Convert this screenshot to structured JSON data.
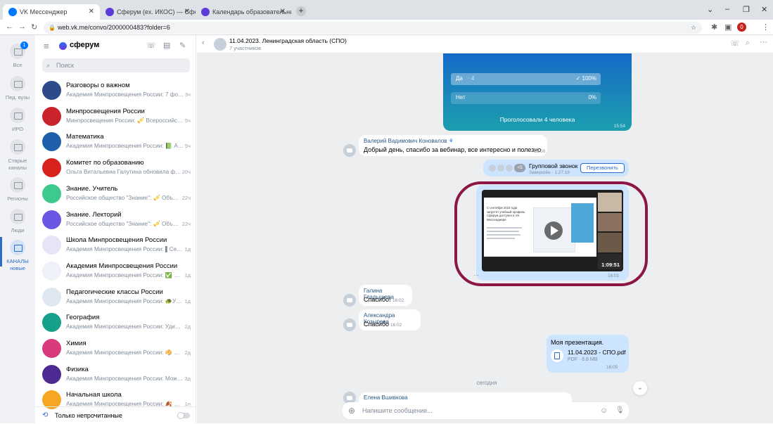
{
  "browser": {
    "tabs": [
      {
        "title": "VK Мессенджер",
        "color": "#0077ff"
      },
      {
        "title": "Сферум (ex. ИКОС) — Сферум",
        "color": "#5b3bd6"
      },
      {
        "title": "Календарь образовательных м…",
        "color": "#5b3bd6"
      }
    ],
    "url": "web.vk.me/convo/2000000483?folder=6",
    "profile_initial": "0"
  },
  "rail": {
    "badge": "1",
    "items": [
      {
        "label": "Все"
      },
      {
        "label": "Пед. вузы"
      },
      {
        "label": "ИРО"
      },
      {
        "label": "Старые каналы"
      },
      {
        "label": "Регионы"
      },
      {
        "label": "Люди"
      },
      {
        "label": "КАНАЛЫ новые"
      }
    ]
  },
  "sidebar": {
    "logo": "сферум",
    "search_placeholder": "Поиск",
    "chats": [
      {
        "name": "Разговоры о важном",
        "preview": "Академия Минпросвещения России: 7 фо…",
        "time": "3ч",
        "color": "#2d4a8a",
        "badge": "РАЗГОВОРЫ О ВАЖНОМ"
      },
      {
        "name": "Минпросвещения России",
        "preview": "Минпросвещения России: 🎺 Всероссийс…",
        "time": "5ч",
        "color": "#c9242b",
        "badge": ""
      },
      {
        "name": "Математика",
        "preview": "Академия Минпросвещения России: 📗 А…",
        "time": "5ч",
        "color": "#1d5fa8",
        "badge": "МАТЕМАТИКА"
      },
      {
        "name": "Комитет по образованию",
        "preview": "Ольга Витальевна Галутина обновила ф…",
        "time": "20ч",
        "color": "#d8231d",
        "badge": ""
      },
      {
        "name": "Знание. Учитель",
        "preview": "Российское общество \"Знание\": 🎺 Объ…",
        "time": "22ч",
        "color": "#3ec98d",
        "badge": "Z"
      },
      {
        "name": "Знание. Лекторий",
        "preview": "Российское общество \"Знание\": 🎺 Объ…",
        "time": "22ч",
        "color": "#6a57e3",
        "badge": "Z"
      },
      {
        "name": "Школа Минпросвещения России",
        "preview": "Академия Минпросвещения России: ▌Се…",
        "time": "1д",
        "color": "#e7e4f7",
        "badge": ""
      },
      {
        "name": "Академия Минпросвещения России",
        "preview": "Академия Минпросвещения России: ✅ …",
        "time": "1д",
        "color": "#eef1f7",
        "badge": ""
      },
      {
        "name": "Педагогические классы России",
        "preview": "Академия Минпросвещения России: 🐢У…",
        "time": "1д",
        "color": "#dfe8f2",
        "badge": ""
      },
      {
        "name": "География",
        "preview": "Академия Минпросвещения России: Уди…",
        "time": "2д",
        "color": "#16a08a",
        "badge": "ГЕОГРАФИЯ"
      },
      {
        "name": "Химия",
        "preview": "Академия Минпросвещения России: 🥠 …",
        "time": "2д",
        "color": "#d83a7d",
        "badge": "ХИМИЯ"
      },
      {
        "name": "Физика",
        "preview": "Академия Минпросвещения России: Мож…",
        "time": "3д",
        "color": "#4b2a91",
        "badge": "ФИЗИКА"
      },
      {
        "name": "Начальная школа",
        "preview": "Академия Минпросвещения России: 🍂 …",
        "time": "1н",
        "color": "#f5a623",
        "badge": "НАЧАЛЬНАЯ ШКОЛА"
      }
    ],
    "unread_only": "Только непрочитанные"
  },
  "chat": {
    "title": "11.04.2023. Ленинградская область (СПО)",
    "subtitle": "7 участников",
    "poll": {
      "options": [
        {
          "label": "Да",
          "count": "4",
          "percent": "100%",
          "fill": 100
        },
        {
          "label": "Нет",
          "count": "",
          "percent": "0%",
          "fill": 0
        }
      ],
      "voted": "Проголосовали 4 человека",
      "time": "15:54"
    },
    "messages": [
      {
        "sender": "Валерий Вадимович Коновалов",
        "text": "Добрый день, спасибо за вебинар, все интересно и полезно",
        "time": "16:00"
      },
      {
        "sender": "Галина Гладышева",
        "text": "Спасибо!",
        "time": "16:02"
      },
      {
        "sender": "Александра Козырева",
        "text": "Спасибо",
        "time": "16:02"
      }
    ],
    "call": {
      "title": "Групповой звонок",
      "status": "Завершён",
      "duration": "1:27:19",
      "extra_count": "+5",
      "recall": "Перезвонить"
    },
    "video": {
      "duration": "1:09:51",
      "time": "16:01",
      "slide_text": "С сентября 2023 года запустят учебный профиль Сферум доступен в VK Мессенджере"
    },
    "file": {
      "caption": "Моя презентация.",
      "name": "11.04.2023 - СПО.pdf",
      "meta": "PDF · 6.8 MB",
      "time": "16:05"
    },
    "divider": "сегодня",
    "last_sender": "Елена Вшивкова",
    "composer_placeholder": "Напишите сообщение..."
  }
}
